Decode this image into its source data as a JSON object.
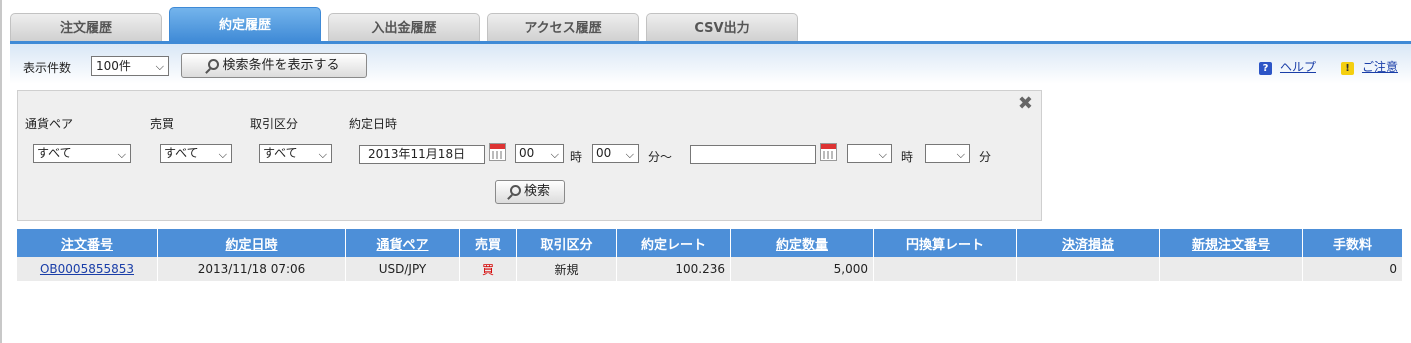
{
  "tabs": [
    "注文履歴",
    "約定履歴",
    "入出金履歴",
    "アクセス履歴",
    "CSV出力"
  ],
  "active_tab": 1,
  "toolbar": {
    "count_label": "表示件数",
    "count_value": "100件",
    "toggle_button": "検索条件を表示する",
    "help": "ヘルプ",
    "caution": "ご注意"
  },
  "search": {
    "labels": {
      "pair": "通貨ペア",
      "side": "売買",
      "type": "取引区分",
      "datetime": "約定日時"
    },
    "pair_value": "すべて",
    "side_value": "すべて",
    "type_value": "すべて",
    "from_date": "2013年11月18日",
    "from_hour": "00",
    "from_min": "00",
    "to_date": "",
    "to_hour": "",
    "to_min": "",
    "unit_hour": "時",
    "unit_min": "分",
    "tilde": "分～",
    "search_button": "検索"
  },
  "table": {
    "headers": [
      "注文番号",
      "約定日時",
      "通貨ペア",
      "売買",
      "取引区分",
      "約定レート",
      "約定数量",
      "円換算レート",
      "決済損益",
      "新規注文番号",
      "手数料"
    ],
    "rows": [
      [
        "OB0005855853",
        "2013/11/18 07:06",
        "USD/JPY",
        "買",
        "新規",
        "100.236",
        "5,000",
        "",
        "",
        "",
        "0"
      ]
    ]
  },
  "colors": {
    "accent": "#4d8fd8",
    "buy": "#d40000",
    "link": "#1a3ea8"
  }
}
